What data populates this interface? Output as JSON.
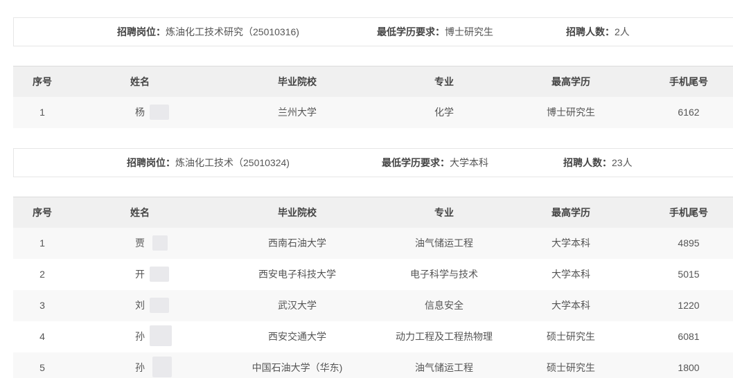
{
  "sections": [
    {
      "post_label": "招聘岗位：",
      "post_value": "炼油化工技术研究（25010316)",
      "edu_label": "最低学历要求：",
      "edu_value": "博士研究生",
      "count_label": "招聘人数：",
      "count_value": "2人",
      "headers": [
        "序号",
        "姓名",
        "毕业院校",
        "专业",
        "最高学历",
        "手机尾号"
      ],
      "rows": [
        {
          "idx": "1",
          "name": "杨",
          "school": "兰州大学",
          "major": "化学",
          "edu": "博士研究生",
          "phone": "6162"
        }
      ]
    },
    {
      "post_label": "招聘岗位：",
      "post_value": "炼油化工技术（25010324)",
      "edu_label": "最低学历要求：",
      "edu_value": "大学本科",
      "count_label": "招聘人数：",
      "count_value": "23人",
      "headers": [
        "序号",
        "姓名",
        "毕业院校",
        "专业",
        "最高学历",
        "手机尾号"
      ],
      "rows": [
        {
          "idx": "1",
          "name": "贾",
          "school": "西南石油大学",
          "major": "油气储运工程",
          "edu": "大学本科",
          "phone": "4895"
        },
        {
          "idx": "2",
          "name": "开",
          "school": "西安电子科技大学",
          "major": "电子科学与技术",
          "edu": "大学本科",
          "phone": "5015"
        },
        {
          "idx": "3",
          "name": "刘",
          "school": "武汉大学",
          "major": "信息安全",
          "edu": "大学本科",
          "phone": "1220"
        },
        {
          "idx": "4",
          "name": "孙",
          "school": "西安交通大学",
          "major": "动力工程及工程热物理",
          "edu": "硕士研究生",
          "phone": "6081"
        },
        {
          "idx": "5",
          "name": "孙",
          "school": "中国石油大学（华东)",
          "major": "油气储运工程",
          "edu": "硕士研究生",
          "phone": "1800"
        }
      ]
    }
  ]
}
